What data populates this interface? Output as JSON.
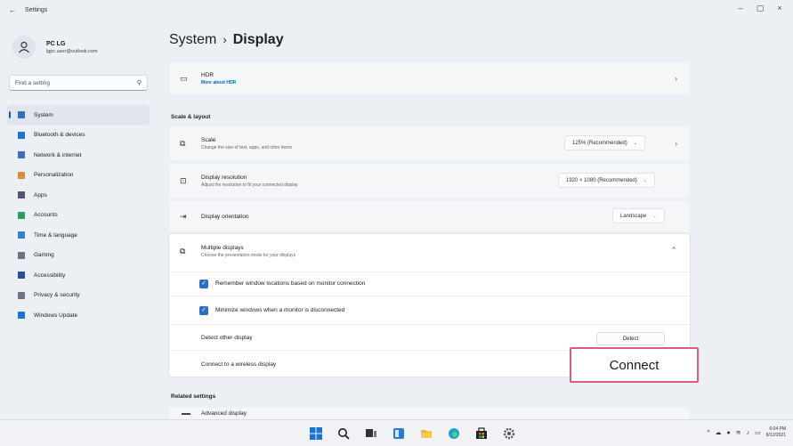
{
  "window": {
    "title": "Settings",
    "back_icon": "back-arrow-icon",
    "minimize": "–",
    "maximize": "▢",
    "close": "×"
  },
  "profile": {
    "name": "PC LG",
    "email": "lgpc.user@outlook.com"
  },
  "search": {
    "placeholder": "Find a setting"
  },
  "sidebar": {
    "items": [
      {
        "label": "System",
        "icon": "monitor-icon",
        "color": "#2b6fc0",
        "active": true
      },
      {
        "label": "Bluetooth & devices",
        "icon": "bluetooth-icon",
        "color": "#1a73d0"
      },
      {
        "label": "Network & internet",
        "icon": "wifi-icon",
        "color": "#3c6fb8"
      },
      {
        "label": "Personalization",
        "icon": "brush-icon",
        "color": "#d98a3a"
      },
      {
        "label": "Apps",
        "icon": "apps-icon",
        "color": "#4a5a70"
      },
      {
        "label": "Accounts",
        "icon": "person-icon",
        "color": "#2e9b66"
      },
      {
        "label": "Time & language",
        "icon": "globe-clock-icon",
        "color": "#2f7fd0"
      },
      {
        "label": "Gaming",
        "icon": "controller-icon",
        "color": "#6b7280"
      },
      {
        "label": "Accessibility",
        "icon": "accessibility-icon",
        "color": "#2a4f9a"
      },
      {
        "label": "Privacy & security",
        "icon": "shield-icon",
        "color": "#6b7280"
      },
      {
        "label": "Windows Update",
        "icon": "update-icon",
        "color": "#1a73d0"
      }
    ]
  },
  "breadcrumb": {
    "parent": "System",
    "separator": "›",
    "current": "Display"
  },
  "hdr": {
    "title": "HDR",
    "link": "More about HDR"
  },
  "section_scale": "Scale & layout",
  "scale": {
    "title": "Scale",
    "subtitle": "Change the size of text, apps, and other items",
    "value": "125% (Recommended)"
  },
  "resolution": {
    "title": "Display resolution",
    "subtitle": "Adjust the resolution to fit your connected display",
    "value": "1920 × 1080 (Recommended)"
  },
  "orientation": {
    "title": "Display orientation",
    "value": "Landscape"
  },
  "multiple": {
    "title": "Multiple displays",
    "subtitle": "Choose the presentation mode for your displays",
    "remember": "Remember window locations based on monitor connection",
    "minimize": "Minimize windows when a monitor is disconnected",
    "detect_label": "Detect other display",
    "detect_button": "Detect",
    "connect_label": "Connect to a wireless display",
    "connect_button": "Connect"
  },
  "section_related": "Related settings",
  "advanced": {
    "title": "Advanced display"
  },
  "clock": {
    "time": "6:04 PM",
    "date": "8/12/2021"
  }
}
